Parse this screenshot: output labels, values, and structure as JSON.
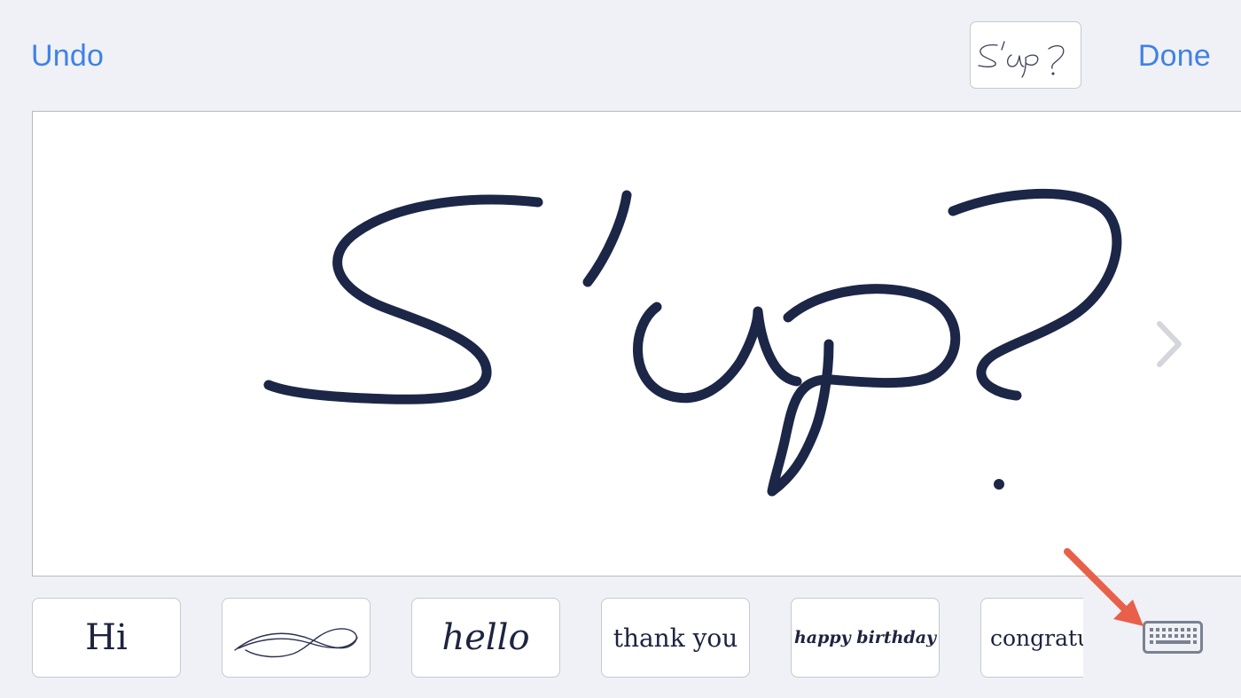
{
  "toolbar": {
    "undo_label": "Undo",
    "done_label": "Done"
  },
  "preview": {
    "text": "S'up?"
  },
  "canvas": {
    "handwriting_text": "S'up?",
    "ink_color": "#1c2647"
  },
  "suggestions": [
    {
      "label": "Hi"
    },
    {
      "label": ""
    },
    {
      "label": "hello"
    },
    {
      "label": "thank you"
    },
    {
      "label": "happy birthday"
    },
    {
      "label": "congratulat"
    }
  ],
  "icons": {
    "next": "chevron-right-icon",
    "keyboard": "keyboard-icon",
    "annotation": "arrow-annotation"
  },
  "colors": {
    "accent": "#3f82e6",
    "background": "#f0f1f6",
    "ink": "#1c2647",
    "annotation_arrow": "#e8604a",
    "chevron": "#d5d6db",
    "keyboard_icon": "#7a8190"
  }
}
